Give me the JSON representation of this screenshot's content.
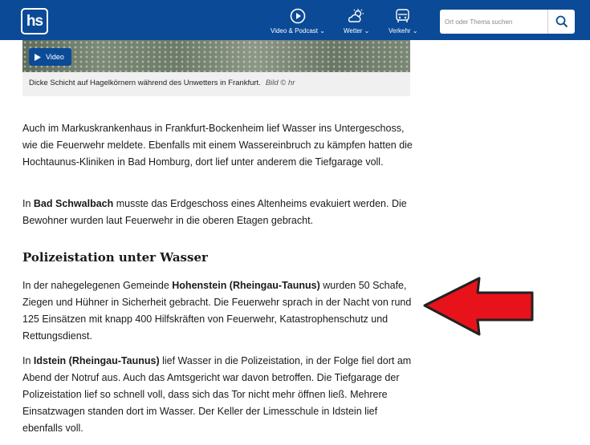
{
  "header": {
    "logo_text": "hs",
    "nav": [
      {
        "label": "Video & Podcast",
        "icon": "play-circle-icon"
      },
      {
        "label": "Wetter",
        "icon": "weather-icon"
      },
      {
        "label": "Verkehr",
        "icon": "car-icon"
      }
    ],
    "search": {
      "placeholder": "Ort oder Thema suchen"
    },
    "colors": {
      "brand": "#0b4a96"
    }
  },
  "media": {
    "badge_label": "Video",
    "caption": "Dicke Schicht auf Hagelkörnern während des Unwetters in Frankfurt.",
    "credit": "Bild © hr"
  },
  "article": {
    "p1": "Auch im Markuskrankenhaus in Frankfurt-Bockenheim lief Wasser ins Untergeschoss, wie die Feuerwehr meldete. Ebenfalls mit einem Wassereinbruch zu kämpfen hatten die Hochtaunus-Kliniken in Bad Homburg, dort lief unter anderem die Tiefgarage voll.",
    "p2": {
      "pre": "In ",
      "bold": "Bad Schwalbach",
      "post": " musste das Erdgeschoss eines Altenheims evakuiert werden. Die Bewohner wurden laut Feuerwehr in die oberen Etagen gebracht."
    },
    "heading": "Polizeistation unter Wasser",
    "p3": {
      "pre": "In der nahegelegenen Gemeinde ",
      "bold": "Hohenstein (Rheingau-Taunus)",
      "post": " wurden 50 Schafe, Ziegen und Hühner in Sicherheit gebracht. Die Feuerwehr sprach in der Nacht von rund 125 Einsätzen mit knapp 400 Hilfskräften von Feuerwehr, Katastrophenschutz und Rettungsdienst."
    },
    "p4": {
      "pre": "In ",
      "bold": "Idstein (Rheingau-Taunus)",
      "post": " lief Wasser in die Polizeistation, in der Folge fiel dort am Abend der Notruf aus. Auch das Amtsgericht war davon betroffen. Die Tiefgarage der Polizeistation lief so schnell voll, dass sich das Tor nicht mehr öffnen ließ. Mehrere Einsatzwagen standen dort im Wasser. Der Keller der Limesschule in Idstein lief ebenfalls voll."
    }
  },
  "annotation": {
    "arrow_color": "#e8121b",
    "arrow_direction": "left"
  }
}
